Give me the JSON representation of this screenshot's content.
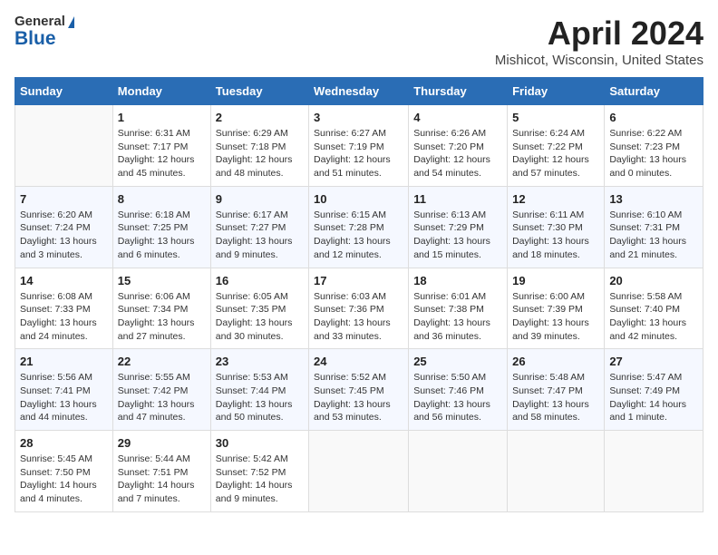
{
  "header": {
    "logo_general": "General",
    "logo_blue": "Blue",
    "month": "April 2024",
    "location": "Mishicot, Wisconsin, United States"
  },
  "calendar": {
    "days_of_week": [
      "Sunday",
      "Monday",
      "Tuesday",
      "Wednesday",
      "Thursday",
      "Friday",
      "Saturday"
    ],
    "weeks": [
      [
        {
          "day": "",
          "sunrise": "",
          "sunset": "",
          "daylight": ""
        },
        {
          "day": "1",
          "sunrise": "Sunrise: 6:31 AM",
          "sunset": "Sunset: 7:17 PM",
          "daylight": "Daylight: 12 hours and 45 minutes."
        },
        {
          "day": "2",
          "sunrise": "Sunrise: 6:29 AM",
          "sunset": "Sunset: 7:18 PM",
          "daylight": "Daylight: 12 hours and 48 minutes."
        },
        {
          "day": "3",
          "sunrise": "Sunrise: 6:27 AM",
          "sunset": "Sunset: 7:19 PM",
          "daylight": "Daylight: 12 hours and 51 minutes."
        },
        {
          "day": "4",
          "sunrise": "Sunrise: 6:26 AM",
          "sunset": "Sunset: 7:20 PM",
          "daylight": "Daylight: 12 hours and 54 minutes."
        },
        {
          "day": "5",
          "sunrise": "Sunrise: 6:24 AM",
          "sunset": "Sunset: 7:22 PM",
          "daylight": "Daylight: 12 hours and 57 minutes."
        },
        {
          "day": "6",
          "sunrise": "Sunrise: 6:22 AM",
          "sunset": "Sunset: 7:23 PM",
          "daylight": "Daylight: 13 hours and 0 minutes."
        }
      ],
      [
        {
          "day": "7",
          "sunrise": "Sunrise: 6:20 AM",
          "sunset": "Sunset: 7:24 PM",
          "daylight": "Daylight: 13 hours and 3 minutes."
        },
        {
          "day": "8",
          "sunrise": "Sunrise: 6:18 AM",
          "sunset": "Sunset: 7:25 PM",
          "daylight": "Daylight: 13 hours and 6 minutes."
        },
        {
          "day": "9",
          "sunrise": "Sunrise: 6:17 AM",
          "sunset": "Sunset: 7:27 PM",
          "daylight": "Daylight: 13 hours and 9 minutes."
        },
        {
          "day": "10",
          "sunrise": "Sunrise: 6:15 AM",
          "sunset": "Sunset: 7:28 PM",
          "daylight": "Daylight: 13 hours and 12 minutes."
        },
        {
          "day": "11",
          "sunrise": "Sunrise: 6:13 AM",
          "sunset": "Sunset: 7:29 PM",
          "daylight": "Daylight: 13 hours and 15 minutes."
        },
        {
          "day": "12",
          "sunrise": "Sunrise: 6:11 AM",
          "sunset": "Sunset: 7:30 PM",
          "daylight": "Daylight: 13 hours and 18 minutes."
        },
        {
          "day": "13",
          "sunrise": "Sunrise: 6:10 AM",
          "sunset": "Sunset: 7:31 PM",
          "daylight": "Daylight: 13 hours and 21 minutes."
        }
      ],
      [
        {
          "day": "14",
          "sunrise": "Sunrise: 6:08 AM",
          "sunset": "Sunset: 7:33 PM",
          "daylight": "Daylight: 13 hours and 24 minutes."
        },
        {
          "day": "15",
          "sunrise": "Sunrise: 6:06 AM",
          "sunset": "Sunset: 7:34 PM",
          "daylight": "Daylight: 13 hours and 27 minutes."
        },
        {
          "day": "16",
          "sunrise": "Sunrise: 6:05 AM",
          "sunset": "Sunset: 7:35 PM",
          "daylight": "Daylight: 13 hours and 30 minutes."
        },
        {
          "day": "17",
          "sunrise": "Sunrise: 6:03 AM",
          "sunset": "Sunset: 7:36 PM",
          "daylight": "Daylight: 13 hours and 33 minutes."
        },
        {
          "day": "18",
          "sunrise": "Sunrise: 6:01 AM",
          "sunset": "Sunset: 7:38 PM",
          "daylight": "Daylight: 13 hours and 36 minutes."
        },
        {
          "day": "19",
          "sunrise": "Sunrise: 6:00 AM",
          "sunset": "Sunset: 7:39 PM",
          "daylight": "Daylight: 13 hours and 39 minutes."
        },
        {
          "day": "20",
          "sunrise": "Sunrise: 5:58 AM",
          "sunset": "Sunset: 7:40 PM",
          "daylight": "Daylight: 13 hours and 42 minutes."
        }
      ],
      [
        {
          "day": "21",
          "sunrise": "Sunrise: 5:56 AM",
          "sunset": "Sunset: 7:41 PM",
          "daylight": "Daylight: 13 hours and 44 minutes."
        },
        {
          "day": "22",
          "sunrise": "Sunrise: 5:55 AM",
          "sunset": "Sunset: 7:42 PM",
          "daylight": "Daylight: 13 hours and 47 minutes."
        },
        {
          "day": "23",
          "sunrise": "Sunrise: 5:53 AM",
          "sunset": "Sunset: 7:44 PM",
          "daylight": "Daylight: 13 hours and 50 minutes."
        },
        {
          "day": "24",
          "sunrise": "Sunrise: 5:52 AM",
          "sunset": "Sunset: 7:45 PM",
          "daylight": "Daylight: 13 hours and 53 minutes."
        },
        {
          "day": "25",
          "sunrise": "Sunrise: 5:50 AM",
          "sunset": "Sunset: 7:46 PM",
          "daylight": "Daylight: 13 hours and 56 minutes."
        },
        {
          "day": "26",
          "sunrise": "Sunrise: 5:48 AM",
          "sunset": "Sunset: 7:47 PM",
          "daylight": "Daylight: 13 hours and 58 minutes."
        },
        {
          "day": "27",
          "sunrise": "Sunrise: 5:47 AM",
          "sunset": "Sunset: 7:49 PM",
          "daylight": "Daylight: 14 hours and 1 minute."
        }
      ],
      [
        {
          "day": "28",
          "sunrise": "Sunrise: 5:45 AM",
          "sunset": "Sunset: 7:50 PM",
          "daylight": "Daylight: 14 hours and 4 minutes."
        },
        {
          "day": "29",
          "sunrise": "Sunrise: 5:44 AM",
          "sunset": "Sunset: 7:51 PM",
          "daylight": "Daylight: 14 hours and 7 minutes."
        },
        {
          "day": "30",
          "sunrise": "Sunrise: 5:42 AM",
          "sunset": "Sunset: 7:52 PM",
          "daylight": "Daylight: 14 hours and 9 minutes."
        },
        {
          "day": "",
          "sunrise": "",
          "sunset": "",
          "daylight": ""
        },
        {
          "day": "",
          "sunrise": "",
          "sunset": "",
          "daylight": ""
        },
        {
          "day": "",
          "sunrise": "",
          "sunset": "",
          "daylight": ""
        },
        {
          "day": "",
          "sunrise": "",
          "sunset": "",
          "daylight": ""
        }
      ]
    ]
  }
}
